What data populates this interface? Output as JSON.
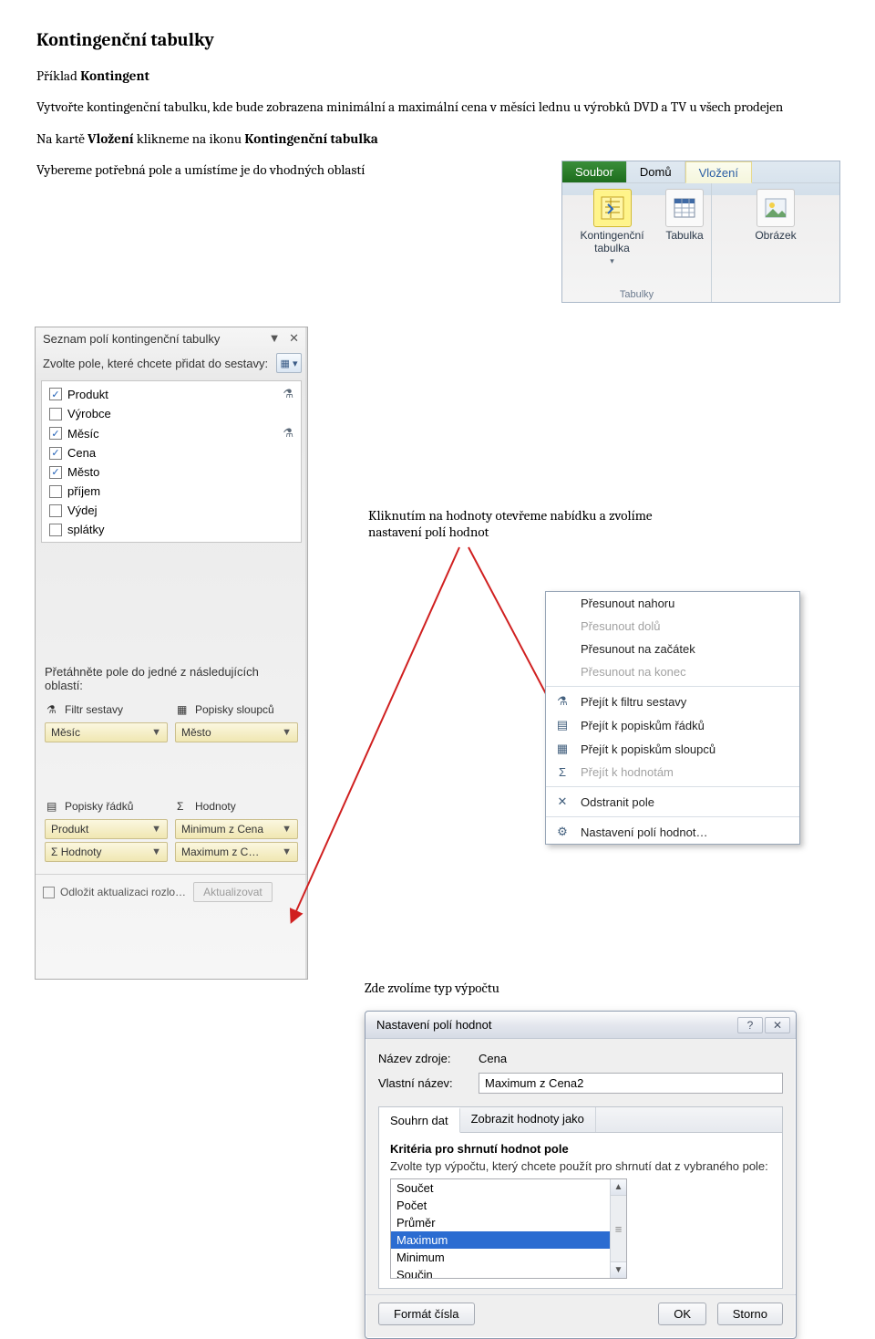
{
  "doc": {
    "title": "Kontingenční tabulky",
    "example_prefix": "Příklad ",
    "example_name": "Kontingent",
    "p1": "Vytvořte kontingenční tabulku, kde bude zobrazena minimální a maximální cena v měsíci lednu u výrobků DVD a TV u všech prodejen",
    "p2a": "Na kartě ",
    "p2b": "Vložení ",
    "p2c": "klikneme na ikonu ",
    "p2d": "Kontingenční tabulka",
    "p3": "Vybereme potřebná pole a umístíme je do vhodných oblastí",
    "ann1a": "Kliknutím na hodnoty otevřeme nabídku a zvolíme",
    "ann1b": "nastavení polí hodnot",
    "ann2": "Zde zvolíme typ výpočtu"
  },
  "ribbon": {
    "file": "Soubor",
    "home": "Domů",
    "insert": "Vložení",
    "pivot": "Kontingenční tabulka",
    "table": "Tabulka",
    "picture": "Obrázek",
    "group": "Tabulky"
  },
  "fieldlist": {
    "title": "Seznam polí kontingenční tabulky",
    "instr": "Zvolte pole, které chcete přidat do sestavy:",
    "fields": [
      {
        "name": "Produkt",
        "checked": true,
        "filter": true
      },
      {
        "name": "Výrobce",
        "checked": false,
        "filter": false
      },
      {
        "name": "Měsíc",
        "checked": true,
        "filter": true
      },
      {
        "name": "Cena",
        "checked": true,
        "filter": false
      },
      {
        "name": "Město",
        "checked": true,
        "filter": false
      },
      {
        "name": "příjem",
        "checked": false,
        "filter": false
      },
      {
        "name": "Výdej",
        "checked": false,
        "filter": false
      },
      {
        "name": "splátky",
        "checked": false,
        "filter": false
      }
    ],
    "dragInstr": "Přetáhněte pole do jedné z následujících oblastí:",
    "area_filter": "Filtr sestavy",
    "area_cols": "Popisky sloupců",
    "area_rows": "Popisky řádků",
    "area_vals": "Hodnoty",
    "chip_filter": "Měsíc",
    "chip_cols": "Město",
    "chip_rows1": "Produkt",
    "chip_rows2": "Hodnoty",
    "chip_vals1": "Minimum z Cena",
    "chip_vals2": "Maximum z C…",
    "defer": "Odložit aktualizaci rozlo…",
    "update": "Aktualizovat",
    "sigma": "Σ"
  },
  "ctx": {
    "moveUp": "Přesunout nahoru",
    "moveDown": "Přesunout dolů",
    "moveBeg": "Přesunout na začátek",
    "moveEnd": "Přesunout na konec",
    "toFilter": "Přejít k filtru sestavy",
    "toRows": "Přejít k popiskům řádků",
    "toCols": "Přejít k popiskům sloupců",
    "toVals": "Přejít k hodnotám",
    "remove": "Odstranit pole",
    "settings": "Nastavení polí hodnot…"
  },
  "dialog": {
    "title": "Nastavení polí hodnot",
    "srcLabel": "Název zdroje:",
    "srcValue": "Cena",
    "nameLabel": "Vlastní název:",
    "nameValue": "Maximum z Cena2",
    "tab1": "Souhrn dat",
    "tab2": "Zobrazit hodnoty jako",
    "groupTitle": "Kritéria pro shrnutí hodnot pole",
    "groupText": "Zvolte typ výpočtu, který chcete použít pro shrnutí dat z vybraného pole:",
    "opts": [
      "Součet",
      "Počet",
      "Průměr",
      "Maximum",
      "Minimum",
      "Součin"
    ],
    "selectedIndex": 3,
    "fmt": "Formát čísla",
    "ok": "OK",
    "cancel": "Storno"
  }
}
